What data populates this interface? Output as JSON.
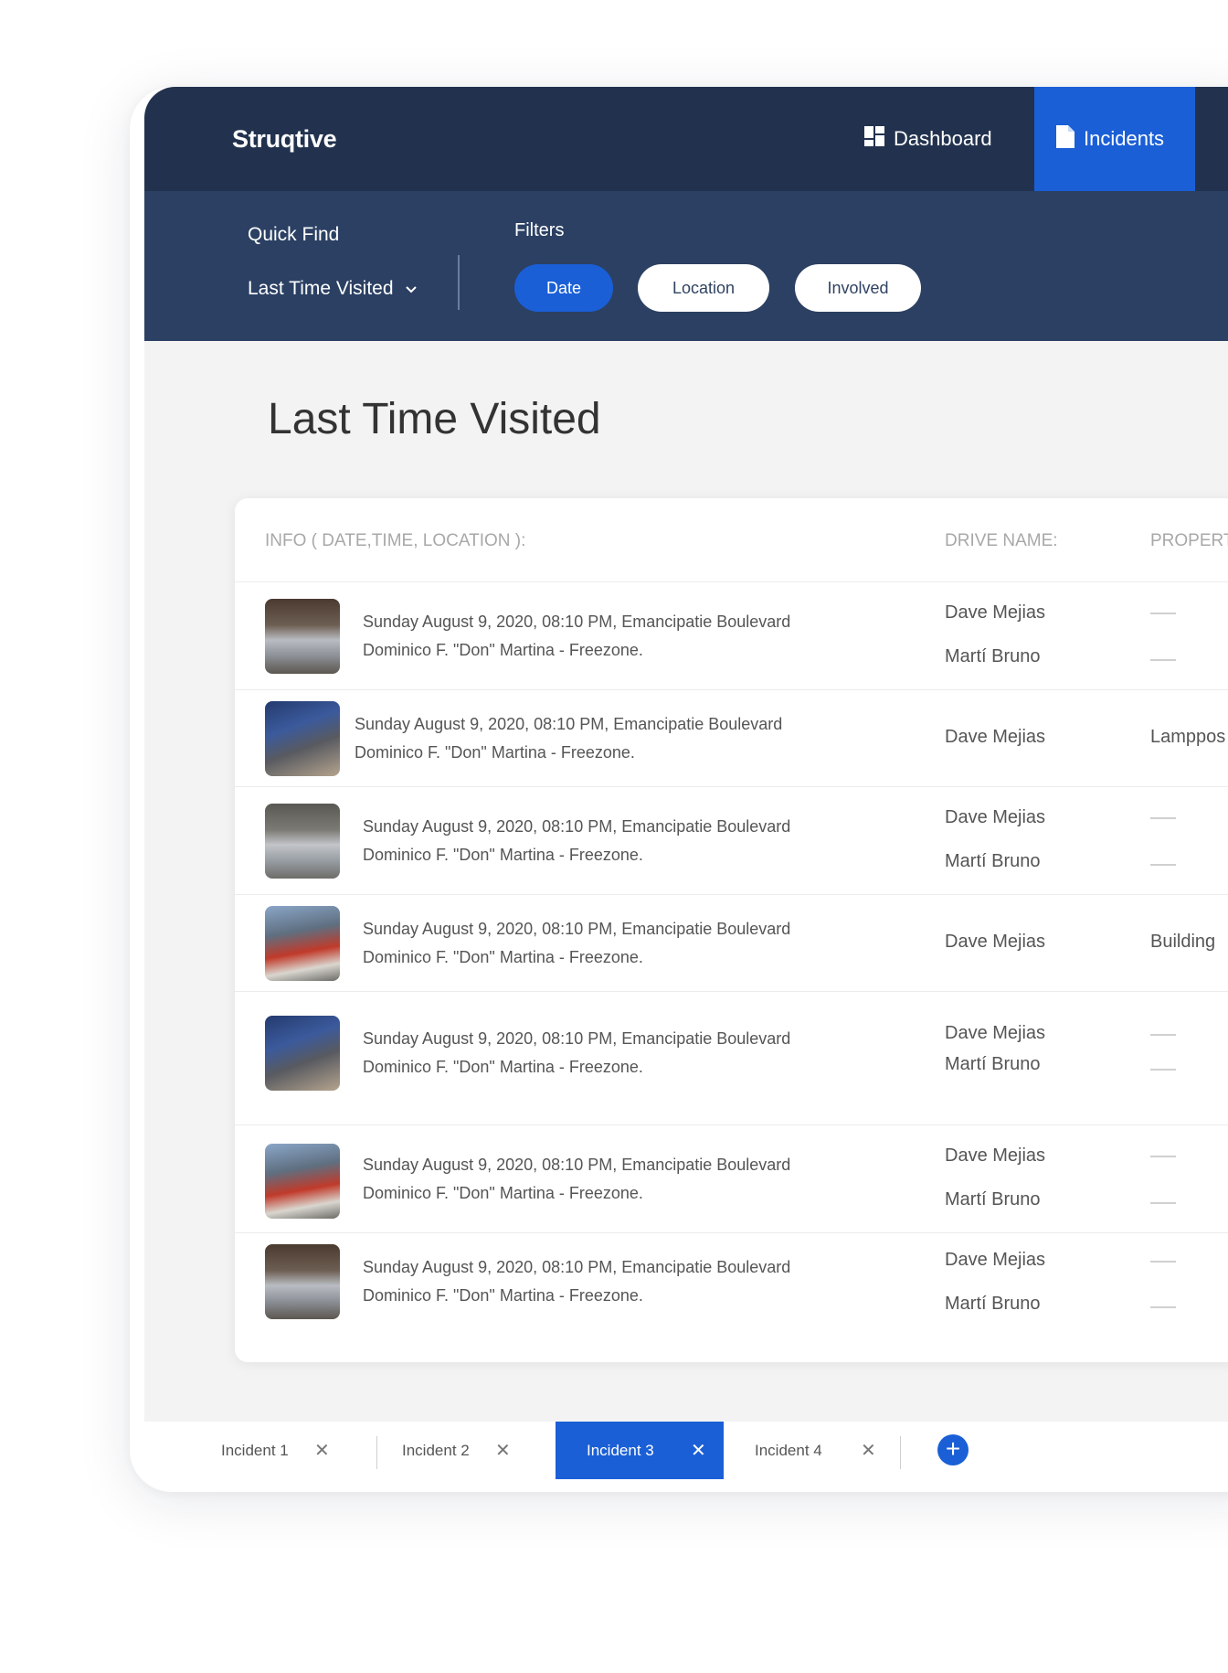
{
  "app": {
    "name": "Struqtive"
  },
  "nav": {
    "items": [
      {
        "label": "Dashboard",
        "icon": "dashboard-icon"
      },
      {
        "label": "Incidents",
        "icon": "document-icon",
        "active": true
      }
    ]
  },
  "quick_find": {
    "label": "Quick Find",
    "selected": "Last Time Visited"
  },
  "filters": {
    "label": "Filters",
    "chips": [
      {
        "label": "Date",
        "active": true
      },
      {
        "label": "Location",
        "active": false
      },
      {
        "label": "Involved",
        "active": false
      }
    ]
  },
  "page": {
    "title": "Last Time Visited"
  },
  "table": {
    "columns": {
      "info": "INFO ( DATE,TIME, LOCATION ):",
      "driver": "DRIVE NAME:",
      "property": "PROPERT"
    },
    "rows": [
      {
        "line1": "Sunday August 9, 2020, 08:10 PM, Emancipatie Boulevard",
        "line2": "Dominico  F. \"Don\" Martina  - Freezone.",
        "driver1": "Dave Mejias",
        "driver2": "Martí Bruno",
        "property": ""
      },
      {
        "line1": "Sunday August 9, 2020, 08:10 PM, Emancipatie Boulevard",
        "line2": "Dominico  F. \"Don\" Martina  - Freezone.",
        "driver1": "Dave Mejias",
        "driver2": "",
        "property": "Lamppos"
      },
      {
        "line1": "Sunday August 9, 2020, 08:10 PM, Emancipatie Boulevard",
        "line2": "Dominico  F. \"Don\" Martina  - Freezone.",
        "driver1": "Dave Mejias",
        "driver2": "Martí Bruno",
        "property": ""
      },
      {
        "line1": "Sunday August 9, 2020, 08:10 PM, Emancipatie Boulevard",
        "line2": "Dominico  F. \"Don\" Martina  - Freezone.",
        "driver1": "Dave Mejias",
        "driver2": "",
        "property": "Building"
      },
      {
        "line1": "Sunday August 9, 2020, 08:10 PM, Emancipatie Boulevard",
        "line2": "Dominico  F. \"Don\" Martina  - Freezone.",
        "driver1": "Dave Mejias",
        "driver2": "Martí Bruno",
        "property": ""
      },
      {
        "line1": "Sunday August 9, 2020, 08:10 PM, Emancipatie Boulevard",
        "line2": "Dominico  F. \"Don\" Martina  - Freezone.",
        "driver1": "Dave Mejias",
        "driver2": "Martí Bruno",
        "property": ""
      },
      {
        "line1": "Sunday August 9, 2020, 08:10 PM, Emancipatie Boulevard",
        "line2": "Dominico  F. \"Don\" Martina  - Freezone.",
        "driver1": "Dave Mejias",
        "driver2": "Martí Bruno",
        "property": ""
      }
    ]
  },
  "tabs": [
    {
      "label": "Incident 1",
      "active": false
    },
    {
      "label": "Incident 2",
      "active": false
    },
    {
      "label": "Incident 3",
      "active": true
    },
    {
      "label": "Incident 4",
      "active": false
    }
  ],
  "colors": {
    "nav_bg": "#22324e",
    "filter_bg": "#2b4063",
    "accent": "#1a5fd6",
    "page_bg": "#f3f3f3"
  }
}
